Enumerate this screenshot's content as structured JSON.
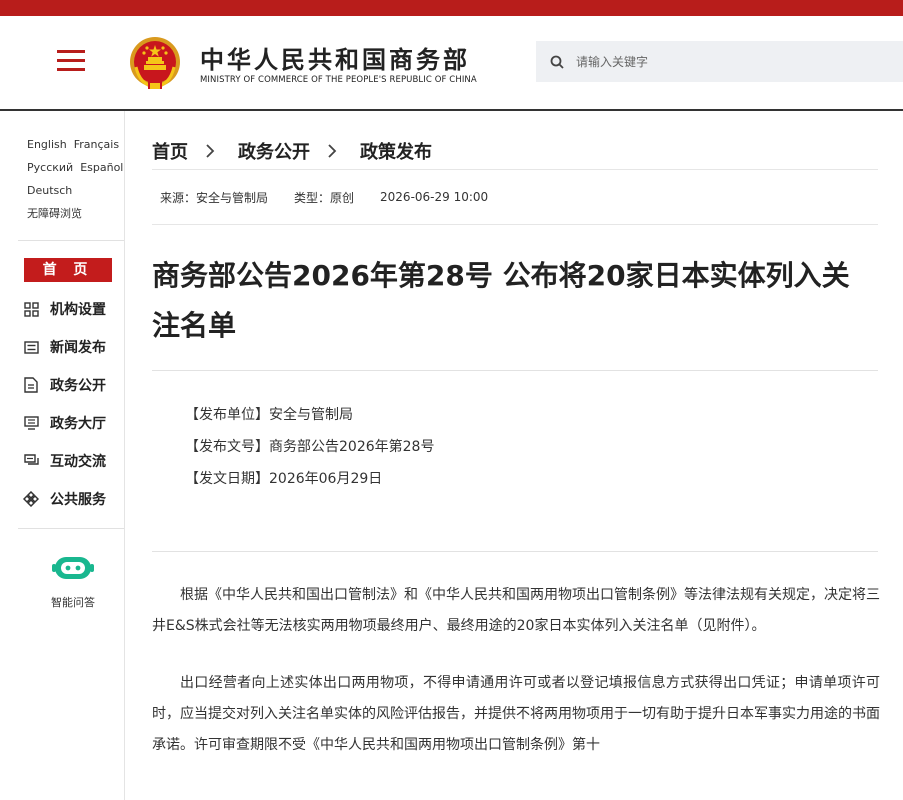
{
  "colors": {
    "brand_red": "#b81d1b",
    "nav_active": "#c31c1c",
    "robot_teal": "#19b78f"
  },
  "header": {
    "title": "中华人民共和国商务部",
    "subtitle": "MINISTRY OF COMMERCE OF THE PEOPLE'S REPUBLIC OF CHINA",
    "search_placeholder": "请输入关键字",
    "menu_icon": "hamburger-menu-icon",
    "emblem": "national-emblem"
  },
  "sidebar": {
    "languages": [
      "English",
      "Français",
      "Русский",
      "Español",
      "Deutsch"
    ],
    "accessibility": "无障碍浏览",
    "home_label": "首 页",
    "nav": [
      {
        "label": "机构设置",
        "icon": "grid-icon"
      },
      {
        "label": "新闻发布",
        "icon": "news-icon"
      },
      {
        "label": "政务公开",
        "icon": "document-icon"
      },
      {
        "label": "政务大厅",
        "icon": "monitor-icon"
      },
      {
        "label": "互动交流",
        "icon": "chat-icon"
      },
      {
        "label": "公共服务",
        "icon": "service-icon"
      }
    ],
    "assistant_label": "智能问答",
    "assistant_icon": "robot-icon"
  },
  "breadcrumb": [
    "首页",
    "政务公开",
    "政策发布"
  ],
  "meta": {
    "source": "来源：安全与管制局",
    "type": "类型：原创",
    "datetime": "2026-06-29 10:00"
  },
  "article": {
    "title": "商务部公告2026年第28号 公布将20家日本实体列入关注名单",
    "info": [
      "【发布单位】安全与管制局",
      "【发布文号】商务部公告2026年第28号",
      "【发文日期】2026年06月29日"
    ],
    "paragraphs": [
      "根据《中华人民共和国出口管制法》和《中华人民共和国两用物项出口管制条例》等法律法规有关规定，决定将三井E&S株式会社等无法核实两用物项最终用户、最终用途的20家日本实体列入关注名单（见附件）。",
      "出口经营者向上述实体出口两用物项，不得申请通用许可或者以登记填报信息方式获得出口凭证；申请单项许可时，应当提交对列入关注名单实体的风险评估报告，并提供不将两用物项用于一切有助于提升日本军事实力用途的书面承诺。许可审查期限不受《中华人民共和国两用物项出口管制条例》第十"
    ]
  }
}
